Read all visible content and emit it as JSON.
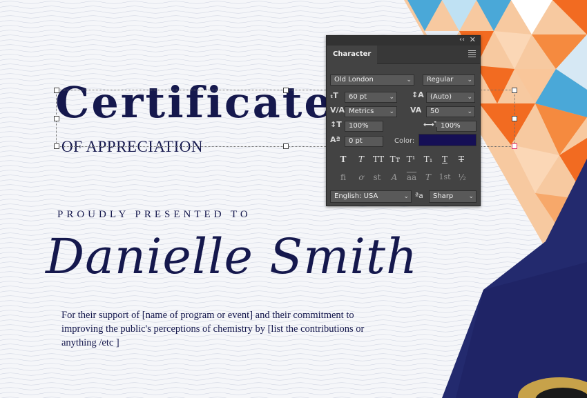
{
  "certificate": {
    "title": "Certificate",
    "subtitle": "OF APPRECIATION",
    "presented_label": "PROUDLY PRESENTED TO",
    "recipient": "Danielle Smith",
    "body": "For their support of [name of program or event] and their commitment to improving the public's perceptions of chemistry by [list the contributions or anything /etc ]"
  },
  "panel": {
    "tab": "Character",
    "collapse_glyph": "‹‹",
    "close_glyph": "✕",
    "font_family": "Old London",
    "font_style": "Regular",
    "font_size": "60 pt",
    "leading": "(Auto)",
    "kerning": "Metrics",
    "tracking": "50",
    "vertical_scale": "100%",
    "horizontal_scale": "100%",
    "baseline_shift": "0 pt",
    "color_label": "Color:",
    "color_value": "#150f55",
    "language": "English: USA",
    "antialias_icon_text": "ªa",
    "antialias": "Sharp",
    "style_buttons": [
      {
        "name": "faux-bold",
        "glyph": "T"
      },
      {
        "name": "faux-italic",
        "glyph": "T"
      },
      {
        "name": "all-caps",
        "glyph": "TT"
      },
      {
        "name": "small-caps",
        "glyph": "Tт"
      },
      {
        "name": "superscript",
        "glyph": "T¹"
      },
      {
        "name": "subscript",
        "glyph": "T₁"
      },
      {
        "name": "underline",
        "glyph": "T"
      },
      {
        "name": "strikethrough",
        "glyph": "T"
      }
    ],
    "opentype_buttons": [
      {
        "name": "ligatures",
        "glyph": "fi"
      },
      {
        "name": "contextual-alternates",
        "glyph": "ơ"
      },
      {
        "name": "discretionary-ligatures",
        "glyph": "st"
      },
      {
        "name": "swash",
        "glyph": "A"
      },
      {
        "name": "stylistic-alternates",
        "glyph": "aa"
      },
      {
        "name": "titling-alternates",
        "glyph": "T"
      },
      {
        "name": "ordinals",
        "glyph": "1st"
      },
      {
        "name": "fractions",
        "glyph": "½"
      }
    ]
  },
  "colors": {
    "navy": "#15184d",
    "panel_bg": "#434343",
    "triangle_orange": "#f26b21",
    "triangle_cyan": "#4aa8d8",
    "band_navy": "#232a6e"
  }
}
